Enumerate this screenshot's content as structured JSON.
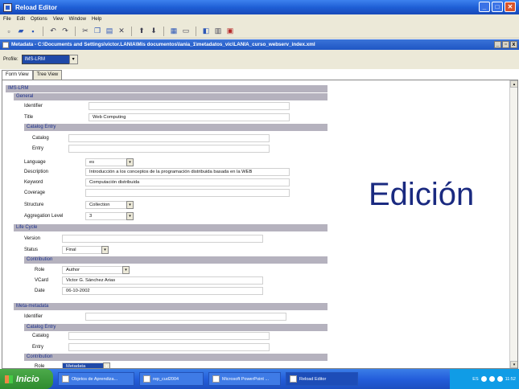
{
  "app": {
    "title": "Reload Editor"
  },
  "menu": [
    "File",
    "Edit",
    "Options",
    "View",
    "Window",
    "Help"
  ],
  "document": {
    "title": "Metadata - C:\\Documents and Settings\\victor.LANIA\\Mis documentos\\lania_1\\metadatos_vic\\LANIA_curso_webserv_index.xml"
  },
  "profile": {
    "label": "Profile:",
    "value": "IMS-LRM"
  },
  "tabs": [
    "Form View",
    "Tree View"
  ],
  "form": {
    "root": "IMS-LRM",
    "general": {
      "heading": "General",
      "identifier_label": "Identifier",
      "identifier_value": "",
      "title_label": "Title",
      "title_value": "Web Computing",
      "catalog_entry_heading": "Catalog Entry",
      "catalog_label": "Catalog",
      "entry_label": "Entry",
      "language_label": "Language",
      "language_value": "es",
      "description_label": "Description",
      "description_value": "Introducción a los conceptos de la programación distribuida basada en la WEB",
      "keyword_label": "Keyword",
      "keyword_value": "Computación distribuida",
      "coverage_label": "Coverage",
      "coverage_value": "",
      "structure_label": "Structure",
      "structure_value": "Collection",
      "aggregation_label": "Aggregation Level",
      "aggregation_value": "3"
    },
    "lifecycle": {
      "heading": "Life Cycle",
      "version_label": "Version",
      "version_value": "",
      "status_label": "Status",
      "status_value": "Final",
      "contribution_heading": "Contribution",
      "role_label": "Role",
      "role_value": "Author",
      "vcard_label": "VCard",
      "vcard_value": "Victor G. Sánchez Arias",
      "date_label": "Date",
      "date_value": "06-10-2002"
    },
    "metametadata": {
      "heading": "Meta-metadata",
      "identifier_label": "Identifier",
      "catalog_entry_heading": "Catalog Entry",
      "catalog_label": "Catalog",
      "entry_label": "Entry",
      "contribution_heading": "Contribution",
      "role_label": "Role",
      "role_value": "Metadata"
    }
  },
  "overlay_text": "Edición",
  "taskbar": {
    "start": "Inicio",
    "tasks": [
      "Objetos de Aprendiza...",
      "rep_cud2004",
      "Microsoft PowerPoint ...",
      "Reload Editor"
    ],
    "tray_lang": "ES",
    "clock": "11:52"
  },
  "colors": {
    "titlebar": "#1f5fd6",
    "section_band": "#b5b2be",
    "section_text": "#1a2f8c",
    "overlay": "#1a2a80"
  }
}
